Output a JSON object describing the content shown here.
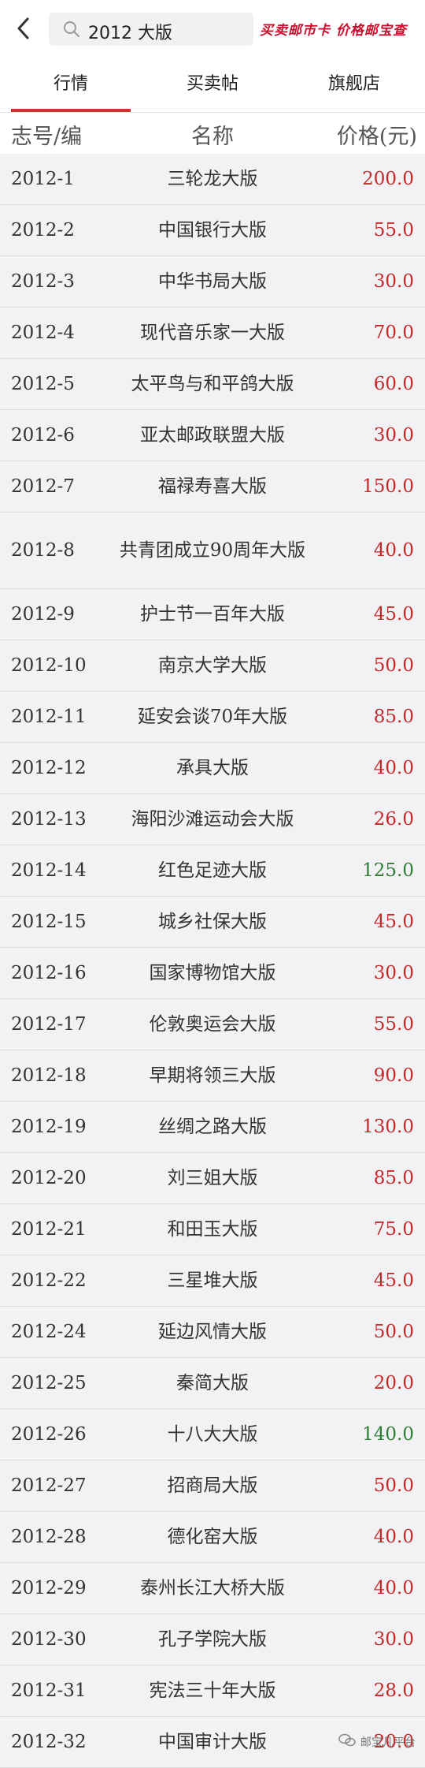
{
  "search": {
    "query": "2012 大版"
  },
  "brand": {
    "text": "买卖邮市卡 价格邮宝查"
  },
  "tabs": [
    {
      "label": "行情",
      "active": true
    },
    {
      "label": "买卖帖",
      "active": false
    },
    {
      "label": "旗舰店",
      "active": false
    }
  ],
  "table": {
    "headers": [
      "志号/编",
      "名称",
      "价格(元)"
    ],
    "rows": [
      {
        "code": "2012-1",
        "name": "三轮龙大版",
        "price": "200.0",
        "color": "red"
      },
      {
        "code": "2012-2",
        "name": "中国银行大版",
        "price": "55.0",
        "color": "red"
      },
      {
        "code": "2012-3",
        "name": "中华书局大版",
        "price": "30.0",
        "color": "red"
      },
      {
        "code": "2012-4",
        "name": "现代音乐家一大版",
        "price": "70.0",
        "color": "red"
      },
      {
        "code": "2012-5",
        "name": "太平鸟与和平鸽大版",
        "price": "60.0",
        "color": "red"
      },
      {
        "code": "2012-6",
        "name": "亚太邮政联盟大版",
        "price": "30.0",
        "color": "red"
      },
      {
        "code": "2012-7",
        "name": "福禄寿喜大版",
        "price": "150.0",
        "color": "red"
      },
      {
        "code": "2012-8",
        "name": "共青团成立90周年大版",
        "price": "40.0",
        "color": "red",
        "tall": true
      },
      {
        "code": "2012-9",
        "name": "护士节一百年大版",
        "price": "45.0",
        "color": "red"
      },
      {
        "code": "2012-10",
        "name": "南京大学大版",
        "price": "50.0",
        "color": "red"
      },
      {
        "code": "2012-11",
        "name": "延安会谈70年大版",
        "price": "85.0",
        "color": "red"
      },
      {
        "code": "2012-12",
        "name": "承具大版",
        "price": "40.0",
        "color": "red"
      },
      {
        "code": "2012-13",
        "name": "海阳沙滩运动会大版",
        "price": "26.0",
        "color": "red"
      },
      {
        "code": "2012-14",
        "name": "红色足迹大版",
        "price": "125.0",
        "color": "green"
      },
      {
        "code": "2012-15",
        "name": "城乡社保大版",
        "price": "45.0",
        "color": "red"
      },
      {
        "code": "2012-16",
        "name": "国家博物馆大版",
        "price": "30.0",
        "color": "red"
      },
      {
        "code": "2012-17",
        "name": "伦敦奥运会大版",
        "price": "55.0",
        "color": "red"
      },
      {
        "code": "2012-18",
        "name": "早期将领三大版",
        "price": "90.0",
        "color": "red"
      },
      {
        "code": "2012-19",
        "name": "丝绸之路大版",
        "price": "130.0",
        "color": "red"
      },
      {
        "code": "2012-20",
        "name": "刘三姐大版",
        "price": "85.0",
        "color": "red"
      },
      {
        "code": "2012-21",
        "name": "和田玉大版",
        "price": "75.0",
        "color": "red"
      },
      {
        "code": "2012-22",
        "name": "三星堆大版",
        "price": "45.0",
        "color": "red"
      },
      {
        "code": "2012-24",
        "name": "延边风情大版",
        "price": "50.0",
        "color": "red"
      },
      {
        "code": "2012-25",
        "name": "秦简大版",
        "price": "20.0",
        "color": "red"
      },
      {
        "code": "2012-26",
        "name": "十八大大版",
        "price": "140.0",
        "color": "green"
      },
      {
        "code": "2012-27",
        "name": "招商局大版",
        "price": "50.0",
        "color": "red"
      },
      {
        "code": "2012-28",
        "name": "德化窑大版",
        "price": "40.0",
        "color": "red"
      },
      {
        "code": "2012-29",
        "name": "泰州长江大桥大版",
        "price": "40.0",
        "color": "red"
      },
      {
        "code": "2012-30",
        "name": "孔子学院大版",
        "price": "30.0",
        "color": "red"
      },
      {
        "code": "2012-31",
        "name": "宪法三十年大版",
        "price": "28.0",
        "color": "red"
      },
      {
        "code": "2012-32",
        "name": "中国审计大版",
        "price": "20.0",
        "color": "red"
      }
    ]
  },
  "watermark": {
    "text": "邮宝凡平台"
  },
  "colors": {
    "accent": "#d32f2f",
    "price_up": "#c62828",
    "price_down": "#2e7d32"
  }
}
